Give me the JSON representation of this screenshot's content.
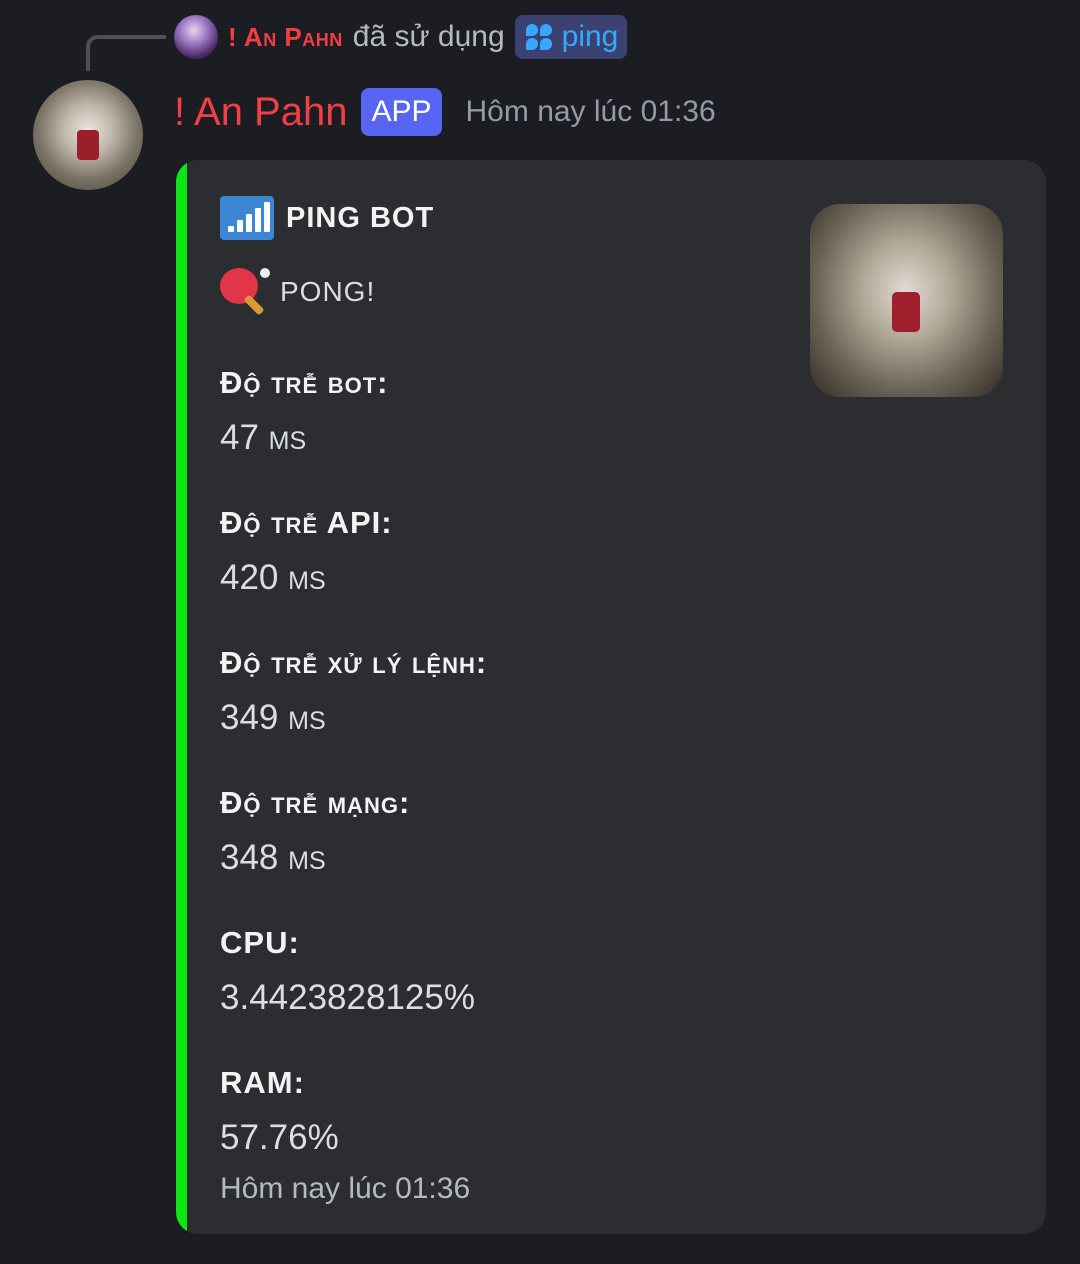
{
  "reply": {
    "user_name": "! An Pahn",
    "used_text": "đã sử dụng",
    "command": "ping"
  },
  "message": {
    "author_name": "! An Pahn",
    "badge": "APP",
    "timestamp": "Hôm nay lúc 01:36"
  },
  "embed": {
    "accent_color": "#0ee614",
    "author": "PING BOT",
    "title": "PONG!",
    "fields": [
      {
        "name": "Độ trễ bot:",
        "value": "47 ms"
      },
      {
        "name": "Độ trễ API:",
        "value": "420 ms"
      },
      {
        "name": "Độ trễ xử lý lệnh:",
        "value": "349 ms"
      },
      {
        "name": "Độ trễ mạng:",
        "value": "348 ms"
      },
      {
        "name": "CPU:",
        "value": "3.4423828125%"
      },
      {
        "name": "RAM:",
        "value": "57.76%"
      }
    ],
    "footer": "Hôm nay lúc 01:36"
  },
  "icons": {
    "author_icon": "signal-bars-icon",
    "title_icon": "ping-pong-paddle-icon",
    "command_icon": "slash-command-icon"
  }
}
